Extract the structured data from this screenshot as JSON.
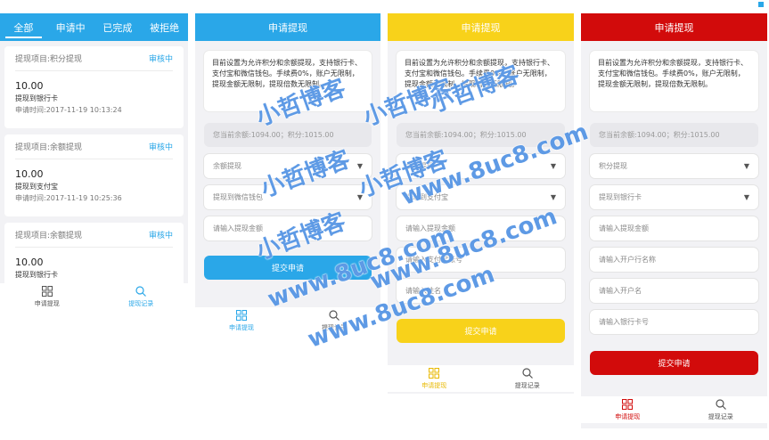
{
  "list_screen": {
    "tabs": [
      "全部",
      "申请中",
      "已完成",
      "被拒绝"
    ],
    "records": [
      {
        "project": "提现项目:积分提现",
        "status": "审核中",
        "amount": "10.00",
        "target": "提现到银行卡",
        "time": "申请时间:2017-11-19 10:13:24"
      },
      {
        "project": "提现项目:余额提现",
        "status": "审核中",
        "amount": "10.00",
        "target": "提现到支付宝",
        "time": "申请时间:2017-11-19 10:25:36"
      },
      {
        "project": "提现项目:余额提现",
        "status": "审核中",
        "amount": "10.00",
        "target": "提现到银行卡",
        "time": ""
      }
    ],
    "nav": [
      "申请提现",
      "提现记录"
    ]
  },
  "blue_screen": {
    "title": "申请提现",
    "notice": "目前设置为允许积分和余额提现，支持银行卡、支付宝和微信钱包。手续费0%，账户无限制，提现金额无限制，提现倍数无限制。",
    "balance": "您当前余额:1094.00；积分:1015.00",
    "type_select": "余额提现",
    "method_select": "提现到微信钱包",
    "amount_placeholder": "请输入提现金额",
    "submit": "提交申请",
    "nav": [
      "申请提现",
      "提现记录"
    ]
  },
  "yellow_screen": {
    "title": "申请提现",
    "notice": "目前设置为允许积分和余额提现，支持银行卡、支付宝和微信钱包。手续费0%，账户无限制，提现金额无限制，提现倍数无限制。",
    "balance": "您当前余额:1094.00；积分:1015.00",
    "type_select": "余额提现",
    "method_select": "提现到支付宝",
    "amount_placeholder": "请输入提现金额",
    "account_placeholder": "请输入支付宝账号",
    "name_placeholder": "请输入姓名",
    "submit": "提交申请",
    "nav": [
      "申请提现",
      "提现记录"
    ]
  },
  "red_screen": {
    "title": "申请提现",
    "notice": "目前设置为允许积分和余额提现，支持银行卡、支付宝和微信钱包。手续费0%，账户无限制，提现金额无限制，提现倍数无限制。",
    "balance": "您当前余额:1094.00；积分:1015.00",
    "type_select": "积分提现",
    "method_select": "提现到银行卡",
    "amount_placeholder": "请输入提现金额",
    "bank_placeholder": "请输入开户行名称",
    "holder_placeholder": "请输入开户名",
    "card_placeholder": "请输入银行卡号",
    "submit": "提交申请",
    "nav": [
      "申请提现",
      "提现记录"
    ]
  },
  "watermark": {
    "cn": "小哲博客",
    "url": "www.8uc8.com"
  },
  "colors": {
    "blue": "#2aa7e8",
    "yellow": "#f8d21a",
    "red": "#d20b0b",
    "watermark": "#2878dc"
  },
  "icons": {
    "apply": "grid-icon",
    "records": "search-icon",
    "select": "triangle-down-icon"
  }
}
